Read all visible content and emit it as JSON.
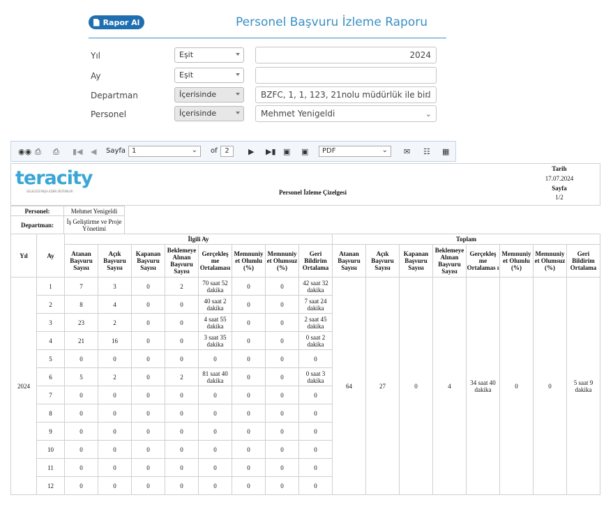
{
  "header": {
    "rapor_button_label": "Rapor Al",
    "title": "Personel Başvuru İzleme Raporu"
  },
  "filters": {
    "yil": {
      "label": "Yıl",
      "operator": "Eşit",
      "value": "2024"
    },
    "ay": {
      "label": "Ay",
      "operator": "Eşit",
      "value": ""
    },
    "departman": {
      "label": "Departman",
      "operator": "İçerisinde",
      "value": "BZFC, 1, 1, 123, 21nolu müdürlük ile birl"
    },
    "personel": {
      "label": "Personel",
      "operator": "İçerisinde",
      "value": "Mehmet Yenigeldi"
    }
  },
  "toolbar": {
    "page_label": "Sayfa",
    "page_value": "1",
    "of_label": "of",
    "total_pages": "2",
    "export_format": "PDF",
    "icons": [
      "binoculars-icon",
      "print-icon",
      "print-pdf-icon",
      "first-page-icon",
      "prev-page-icon",
      "next-page-icon",
      "last-page-icon",
      "save-icon",
      "save-all-icon",
      "email-icon",
      "excel-icon",
      "grid-icon"
    ]
  },
  "report": {
    "logo_text": "teracity",
    "logo_subtext": "GELECEĞİ İNŞA EDEN SİSTEMLER",
    "title": "Personel İzleme Çizelgesi",
    "tarih_label": "Tarih",
    "tarih_value": "17.07.2024",
    "sayfa_label": "Sayfa",
    "sayfa_value": "1/2",
    "personel_label": "Personel:",
    "personel_value": "Mehmet Yenigeldi",
    "departman_label": "Departman:",
    "departman_value": "İş Geliştirme ve Proje Yönetimi",
    "col_yil": "Yıl",
    "col_ay": "Ay",
    "group_ilgili": "İlgili Ay",
    "group_toplam": "Toplam",
    "subcols": [
      "Atanan Başvuru Sayısı",
      "Açık Başvuru Sayısı",
      "Kapanan Başvuru Sayısı",
      "Beklemeye Alınan Başvuru Sayısı",
      "Gerçekleş me Ortalaması",
      "Memnuniy et Olumlu (%)",
      "Memnuniy et Olumsuz (%)",
      "Geri Bildirim Ortalama"
    ],
    "subcols_toplam": [
      "Atanan Başvuru Sayısı",
      "Açık Başvuru Sayısı",
      "Kapanan Başvuru Sayısı",
      "Beklemeye Alınan Başvuru Sayısı",
      "Gerçekleş me Ortalamas ı",
      "Memnuniy et Olumlu (%)",
      "Memnuniy et Olumsuz (%)",
      "Geri Bildirim Ortalama"
    ],
    "year": "2024",
    "rows": [
      [
        "1",
        "7",
        "3",
        "0",
        "2",
        "70 saat 52 dakika",
        "0",
        "0",
        "42 saat 32 dakika"
      ],
      [
        "2",
        "8",
        "4",
        "0",
        "0",
        "40 saat 2 dakika",
        "0",
        "0",
        "7 saat 24 dakika"
      ],
      [
        "3",
        "23",
        "2",
        "0",
        "0",
        "4 saat 55 dakika",
        "0",
        "0",
        "2 saat 45 dakika"
      ],
      [
        "4",
        "21",
        "16",
        "0",
        "0",
        "3 saat 35 dakika",
        "0",
        "0",
        "0 saat 2 dakika"
      ],
      [
        "5",
        "0",
        "0",
        "0",
        "0",
        "0",
        "0",
        "0",
        "0"
      ],
      [
        "6",
        "5",
        "2",
        "0",
        "2",
        "81 saat 40 dakika",
        "0",
        "0",
        "0 saat 3 dakika"
      ],
      [
        "7",
        "0",
        "0",
        "0",
        "0",
        "0",
        "0",
        "0",
        "0"
      ],
      [
        "8",
        "0",
        "0",
        "0",
        "0",
        "0",
        "0",
        "0",
        "0"
      ],
      [
        "9",
        "0",
        "0",
        "0",
        "0",
        "0",
        "0",
        "0",
        "0"
      ],
      [
        "10",
        "0",
        "0",
        "0",
        "0",
        "0",
        "0",
        "0",
        "0"
      ],
      [
        "11",
        "0",
        "0",
        "0",
        "0",
        "0",
        "0",
        "0",
        "0"
      ],
      [
        "12",
        "0",
        "0",
        "0",
        "0",
        "0",
        "0",
        "0",
        "0"
      ]
    ],
    "totals": [
      "64",
      "27",
      "0",
      "4",
      "34 saat 40 dakika",
      "0",
      "0",
      "5 saat 9 dakika"
    ]
  }
}
